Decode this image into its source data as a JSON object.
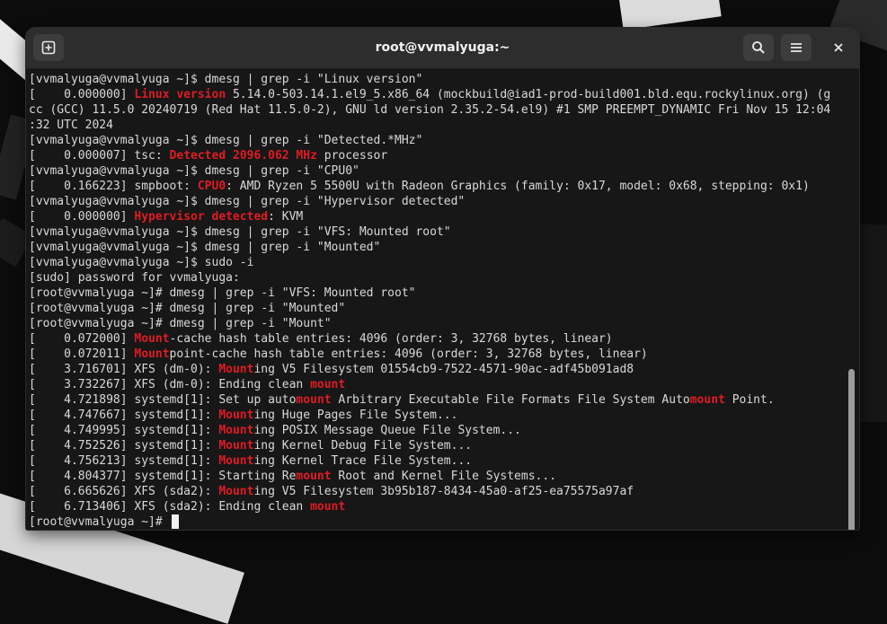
{
  "window": {
    "title": "root@vvmalyuga:~",
    "icons": {
      "new_tab": "new-tab-icon",
      "search": "search-icon",
      "menu": "hamburger-menu-icon",
      "close": "close-icon"
    }
  },
  "colors": {
    "highlight": "#e01b24",
    "text": "#d9d9d9",
    "background": "#171717"
  },
  "terminal": {
    "lines": [
      [
        {
          "t": "[vvmalyuga@vvmalyuga ~]$ dmesg | grep -i \"Linux version\""
        }
      ],
      [
        {
          "t": "[    0.000000] "
        },
        {
          "t": "Linux version",
          "hl": true
        },
        {
          "t": " 5.14.0-503.14.1.el9_5.x86_64 (mockbuild@iad1-prod-build001.bld.equ.rockylinux.org) (g"
        }
      ],
      [
        {
          "t": "cc (GCC) 11.5.0 20240719 (Red Hat 11.5.0-2), GNU ld version 2.35.2-54.el9) #1 SMP PREEMPT_DYNAMIC Fri Nov 15 12:04"
        }
      ],
      [
        {
          "t": ":32 UTC 2024"
        }
      ],
      [
        {
          "t": "[vvmalyuga@vvmalyuga ~]$ dmesg | grep -i \"Detected.*MHz\""
        }
      ],
      [
        {
          "t": "[    0.000007] tsc: "
        },
        {
          "t": "Detected 2096.062 MHz",
          "hl": true
        },
        {
          "t": " processor"
        }
      ],
      [
        {
          "t": "[vvmalyuga@vvmalyuga ~]$ dmesg | grep -i \"CPU0\""
        }
      ],
      [
        {
          "t": "[    0.166223] smpboot: "
        },
        {
          "t": "CPU0",
          "hl": true
        },
        {
          "t": ": AMD Ryzen 5 5500U with Radeon Graphics (family: 0x17, model: 0x68, stepping: 0x1)"
        }
      ],
      [
        {
          "t": "[vvmalyuga@vvmalyuga ~]$ dmesg | grep -i \"Hypervisor detected\""
        }
      ],
      [
        {
          "t": "[    0.000000] "
        },
        {
          "t": "Hypervisor detected",
          "hl": true
        },
        {
          "t": ": KVM"
        }
      ],
      [
        {
          "t": "[vvmalyuga@vvmalyuga ~]$ dmesg | grep -i \"VFS: Mounted root\""
        }
      ],
      [
        {
          "t": "[vvmalyuga@vvmalyuga ~]$ dmesg | grep -i \"Mounted\""
        }
      ],
      [
        {
          "t": "[vvmalyuga@vvmalyuga ~]$ sudo -i"
        }
      ],
      [
        {
          "t": "[sudo] password for vvmalyuga:"
        }
      ],
      [
        {
          "t": "[root@vvmalyuga ~]# dmesg | grep -i \"VFS: Mounted root\""
        }
      ],
      [
        {
          "t": "[root@vvmalyuga ~]# dmesg | grep -i \"Mounted\""
        }
      ],
      [
        {
          "t": "[root@vvmalyuga ~]# dmesg | grep -i \"Mount\""
        }
      ],
      [
        {
          "t": "[    0.072000] "
        },
        {
          "t": "Mount",
          "hl": true
        },
        {
          "t": "-cache hash table entries: 4096 (order: 3, 32768 bytes, linear)"
        }
      ],
      [
        {
          "t": "[    0.072011] "
        },
        {
          "t": "Mount",
          "hl": true
        },
        {
          "t": "point-cache hash table entries: 4096 (order: 3, 32768 bytes, linear)"
        }
      ],
      [
        {
          "t": "[    3.716701] XFS (dm-0): "
        },
        {
          "t": "Mount",
          "hl": true
        },
        {
          "t": "ing V5 Filesystem 01554cb9-7522-4571-90ac-adf45b091ad8"
        }
      ],
      [
        {
          "t": "[    3.732267] XFS (dm-0): Ending clean "
        },
        {
          "t": "mount",
          "hl": true
        }
      ],
      [
        {
          "t": "[    4.721898] systemd[1]: Set up auto"
        },
        {
          "t": "mount",
          "hl": true
        },
        {
          "t": " Arbitrary Executable File Formats File System Auto"
        },
        {
          "t": "mount",
          "hl": true
        },
        {
          "t": " Point."
        }
      ],
      [
        {
          "t": "[    4.747667] systemd[1]: "
        },
        {
          "t": "Mount",
          "hl": true
        },
        {
          "t": "ing Huge Pages File System..."
        }
      ],
      [
        {
          "t": "[    4.749995] systemd[1]: "
        },
        {
          "t": "Mount",
          "hl": true
        },
        {
          "t": "ing POSIX Message Queue File System..."
        }
      ],
      [
        {
          "t": "[    4.752526] systemd[1]: "
        },
        {
          "t": "Mount",
          "hl": true
        },
        {
          "t": "ing Kernel Debug File System..."
        }
      ],
      [
        {
          "t": "[    4.756213] systemd[1]: "
        },
        {
          "t": "Mount",
          "hl": true
        },
        {
          "t": "ing Kernel Trace File System..."
        }
      ],
      [
        {
          "t": "[    4.804377] systemd[1]: Starting Re"
        },
        {
          "t": "mount",
          "hl": true
        },
        {
          "t": " Root and Kernel File Systems..."
        }
      ],
      [
        {
          "t": "[    6.665626] XFS (sda2): "
        },
        {
          "t": "Mount",
          "hl": true
        },
        {
          "t": "ing V5 Filesystem 3b95b187-8434-45a0-af25-ea75575a97af"
        }
      ],
      [
        {
          "t": "[    6.713406] XFS (sda2): Ending clean "
        },
        {
          "t": "mount",
          "hl": true
        }
      ]
    ],
    "prompt": "[root@vvmalyuga ~]# "
  }
}
